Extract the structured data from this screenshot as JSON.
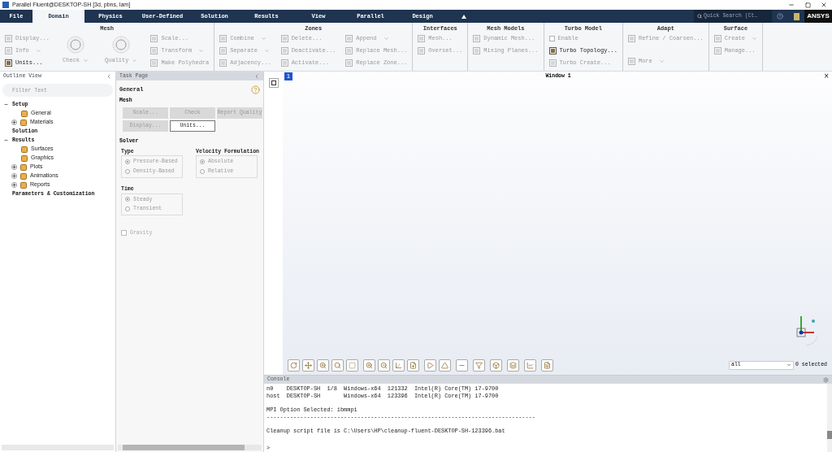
{
  "window": {
    "title": "Parallel Fluent@DESKTOP-SH  [3d, pbns, lam]"
  },
  "tabs": [
    {
      "label": "File",
      "selected": false
    },
    {
      "label": "Domain",
      "selected": true
    },
    {
      "label": "Physics",
      "selected": false
    },
    {
      "label": "User-Defined",
      "selected": false
    },
    {
      "label": "Solution",
      "selected": false
    },
    {
      "label": "Results",
      "selected": false
    },
    {
      "label": "View",
      "selected": false
    },
    {
      "label": "Parallel",
      "selected": false
    },
    {
      "label": "Design",
      "selected": false
    }
  ],
  "quick_search": {
    "placeholder": "Quick Search (Ct…"
  },
  "brand": "ANSYS",
  "ribbon_groups": [
    {
      "title": "Mesh",
      "columns": [
        [
          {
            "label": "Display...",
            "disabled": true
          },
          {
            "label": "Info",
            "disabled": true,
            "menu": true
          },
          {
            "label": "Units...",
            "disabled": false
          }
        ],
        [
          {
            "label": "Check",
            "kind": "large",
            "disabled": true,
            "menu": true
          }
        ],
        [
          {
            "label": "Quality",
            "kind": "large",
            "disabled": true,
            "menu": true
          }
        ],
        [
          {
            "label": "Scale...",
            "disabled": true
          },
          {
            "label": "Transform",
            "disabled": true,
            "menu": true
          },
          {
            "label": "Make Polyhedra",
            "disabled": true
          }
        ]
      ]
    },
    {
      "title": "Zones",
      "columns": [
        [
          {
            "label": "Combine",
            "disabled": true,
            "menu": true
          },
          {
            "label": "Separate",
            "disabled": true,
            "menu": true
          },
          {
            "label": "Adjacency...",
            "disabled": true
          }
        ],
        [
          {
            "label": "Delete...",
            "disabled": true
          },
          {
            "label": "Deactivate...",
            "disabled": true
          },
          {
            "label": "Activate...",
            "disabled": true
          }
        ],
        [
          {
            "label": "Append",
            "disabled": true,
            "menu": true
          },
          {
            "label": "Replace Mesh...",
            "disabled": true
          },
          {
            "label": "Replace Zone...",
            "disabled": true
          }
        ]
      ]
    },
    {
      "title": "Interfaces",
      "columns": [
        [
          {
            "label": "Mesh...",
            "disabled": true
          },
          {
            "label": "Overset...",
            "disabled": true
          }
        ]
      ]
    },
    {
      "title": "Mesh Models",
      "columns": [
        [
          {
            "label": "Dynamic Mesh...",
            "disabled": true
          },
          {
            "label": "Mixing Planes...",
            "disabled": true
          }
        ]
      ]
    },
    {
      "title": "Turbo Model",
      "columns": [
        [
          {
            "label": "Enable",
            "kind": "checkbox",
            "checked": false,
            "disabled": true
          },
          {
            "label": "Turbo Topology...",
            "disabled": false
          },
          {
            "label": "Turbo Create...",
            "disabled": true
          }
        ]
      ]
    },
    {
      "title": "Adapt",
      "columns": [
        [
          {
            "label": "Refine / Coarsen...",
            "disabled": true
          },
          {
            "label": "More",
            "disabled": true,
            "menu": true
          }
        ]
      ]
    },
    {
      "title": "Surface",
      "columns": [
        [
          {
            "label": "Create",
            "disabled": true,
            "menu": true
          },
          {
            "label": "Manage...",
            "disabled": true
          }
        ]
      ]
    }
  ],
  "outline": {
    "title": "Outline View",
    "filter_placeholder": "Filter Text",
    "tree": [
      {
        "label": "Setup",
        "kind": "section",
        "expanded": true,
        "children": [
          {
            "label": "General",
            "kind": "item"
          },
          {
            "label": "Materials",
            "kind": "item",
            "expanded": false
          }
        ]
      },
      {
        "label": "Solution",
        "kind": "section"
      },
      {
        "label": "Results",
        "kind": "section",
        "expanded": true,
        "children": [
          {
            "label": "Surfaces",
            "kind": "item"
          },
          {
            "label": "Graphics",
            "kind": "item"
          },
          {
            "label": "Plots",
            "kind": "item",
            "expanded": false
          },
          {
            "label": "Animations",
            "kind": "item",
            "expanded": false
          },
          {
            "label": "Reports",
            "kind": "item",
            "expanded": false
          }
        ]
      },
      {
        "label": "Parameters & Customization",
        "kind": "section"
      }
    ]
  },
  "task_page": {
    "title": "Task Page",
    "heading": "General",
    "mesh_label": "Mesh",
    "mesh_buttons": [
      {
        "label": "Scale...",
        "disabled": true
      },
      {
        "label": "Check",
        "disabled": true
      },
      {
        "label": "Report Quality",
        "disabled": true
      },
      {
        "label": "Display...",
        "disabled": true
      },
      {
        "label": "Units...",
        "disabled": false
      }
    ],
    "solver_label": "Solver",
    "type": {
      "label": "Type",
      "options": [
        {
          "label": "Pressure-Based",
          "selected": true
        },
        {
          "label": "Density-Based",
          "selected": false
        }
      ]
    },
    "velocity": {
      "label": "Velocity Formulation",
      "options": [
        {
          "label": "Absolute",
          "selected": true
        },
        {
          "label": "Relative",
          "selected": false
        }
      ]
    },
    "time": {
      "label": "Time",
      "options": [
        {
          "label": "Steady",
          "selected": true
        },
        {
          "label": "Transient",
          "selected": false
        }
      ]
    },
    "gravity": {
      "label": "Gravity",
      "checked": false
    }
  },
  "graphics": {
    "badge": "1",
    "title": "Window 1",
    "close": "×",
    "selection": {
      "value": "all",
      "count": "0 selected"
    }
  },
  "console": {
    "title": "Console",
    "blocks": [
      [
        "n0    DESKTOP-SH  1/8  Windows-x64  121332  Intel(R) Core(TM) i7-9700",
        "host  DESKTOP-SH       Windows-x64  123396  Intel(R) Core(TM) i7-9700"
      ],
      [
        "MPI Option Selected: ibmmpi",
        "--------------------------------------------------------------------------------"
      ],
      [
        "Cleanup script file is C:\\Users\\HP\\cleanup-fluent-DESKTOP-SH-123396.bat"
      ]
    ],
    "prompt": ">"
  }
}
